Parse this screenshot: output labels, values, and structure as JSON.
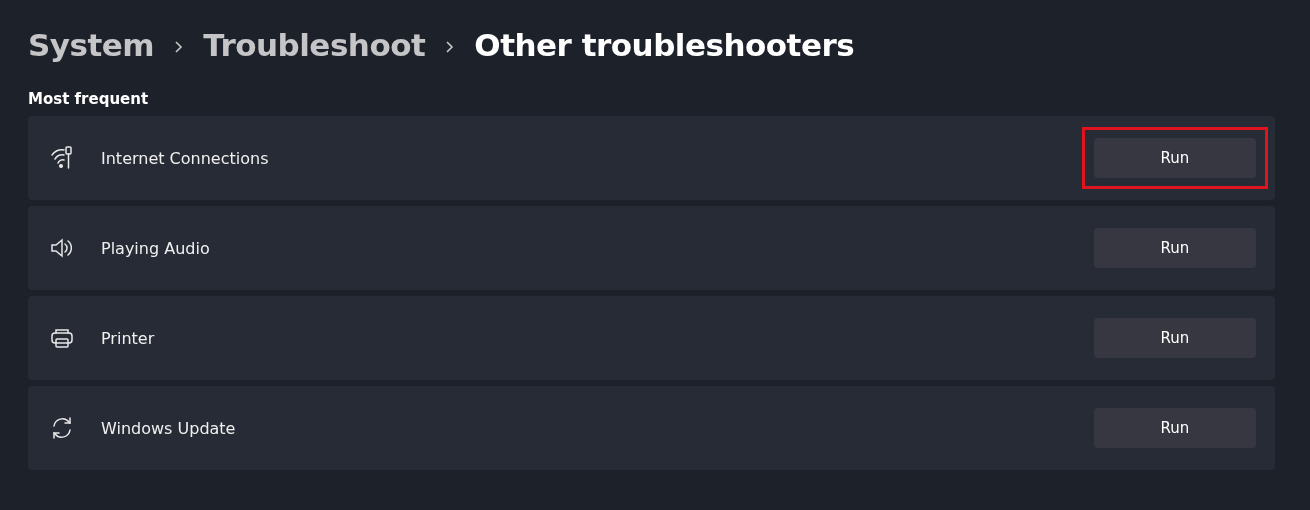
{
  "breadcrumb": [
    {
      "label": "System",
      "current": false
    },
    {
      "label": "Troubleshoot",
      "current": false
    },
    {
      "label": "Other troubleshooters",
      "current": true
    }
  ],
  "section_title": "Most frequent",
  "troubleshooters": [
    {
      "name": "Internet Connections",
      "button": "Run",
      "highlighted": true
    },
    {
      "name": "Playing Audio",
      "button": "Run",
      "highlighted": false
    },
    {
      "name": "Printer",
      "button": "Run",
      "highlighted": false
    },
    {
      "name": "Windows Update",
      "button": "Run",
      "highlighted": false
    }
  ]
}
